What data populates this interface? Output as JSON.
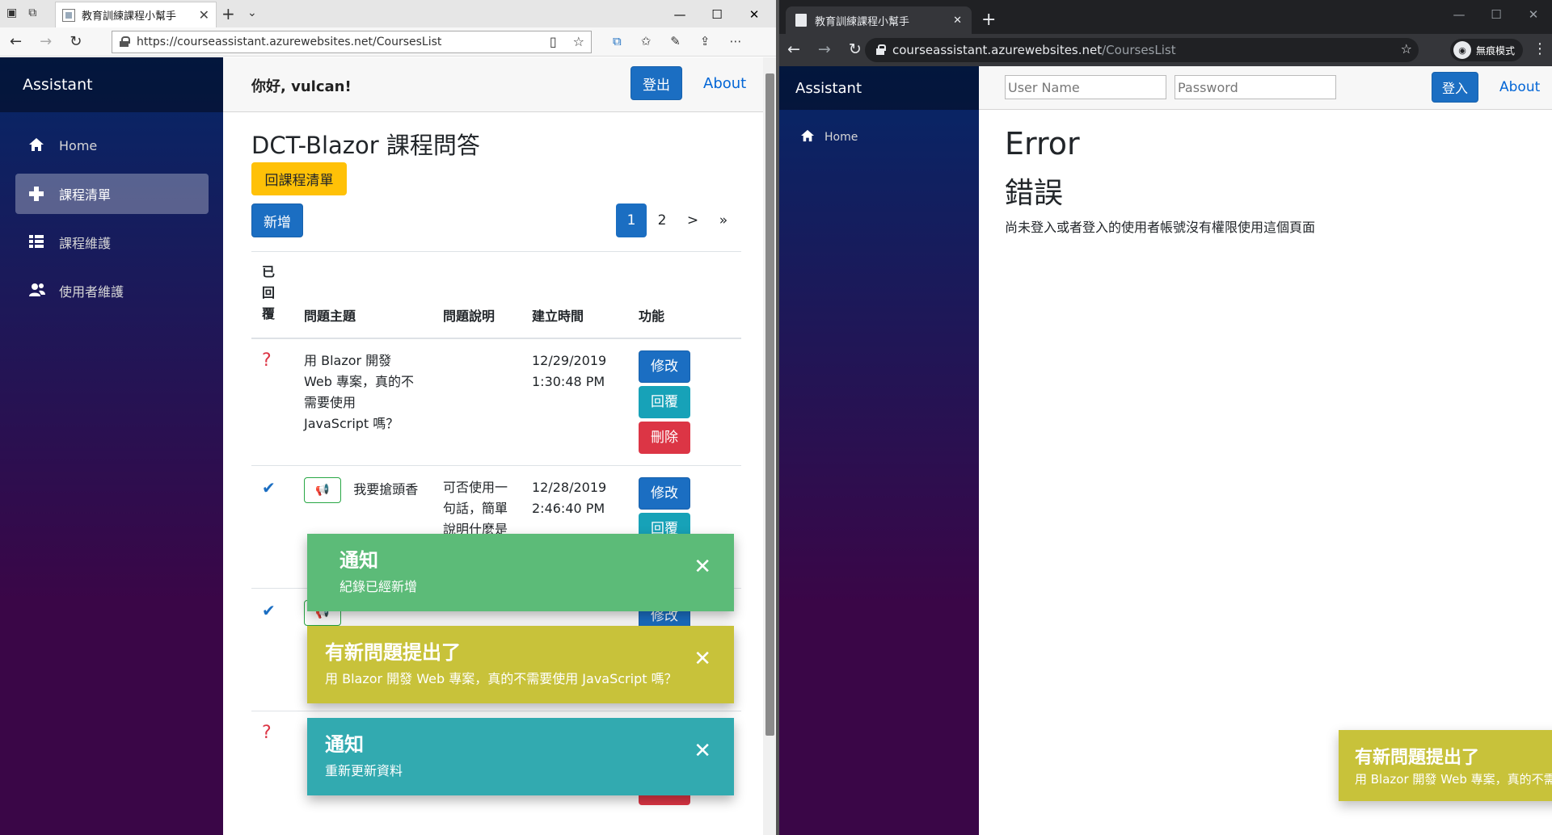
{
  "left": {
    "tab_title": "教育訓練課程小幫手",
    "url": "https://courseassistant.azurewebsites.net/CoursesList",
    "sidebar": {
      "brand": "Assistant",
      "items": [
        {
          "label": "Home",
          "icon": "home-icon"
        },
        {
          "label": "課程清單",
          "icon": "plus-icon"
        },
        {
          "label": "課程維護",
          "icon": "list-icon"
        },
        {
          "label": "使用者維護",
          "icon": "people-icon"
        }
      ]
    },
    "greeting": "你好, vulcan!",
    "logout_label": "登出",
    "about_label": "About",
    "page_title": "DCT-Blazor 課程問答",
    "back_label": "回課程清單",
    "add_label": "新增",
    "pager": [
      "1",
      "2",
      ">",
      "»"
    ],
    "columns": [
      "已回覆",
      "問題主題",
      "問題說明",
      "建立時間",
      "功能"
    ],
    "rows": [
      {
        "answered": "?",
        "subject": "用 Blazor 開發 Web 專案，真的不需要使用 JavaScript 嗎？",
        "desc": "",
        "date": "12/29/2019",
        "time": "1:30:48 PM"
      },
      {
        "answered": "✔",
        "subject": "我要搶頭香",
        "desc": "可否使用一句話，簡單說明什麼是",
        "date": "12/28/2019",
        "time": "2:46:40 PM"
      },
      {
        "answered": "✔",
        "subject": "",
        "desc": "",
        "date": "",
        "time": ""
      },
      {
        "answered": "?",
        "subject": "",
        "desc": "",
        "date": "",
        "time": ""
      }
    ],
    "btn_edit": "修改",
    "btn_reply": "回覆",
    "btn_delete": "刪除",
    "toasts": [
      {
        "title": "通知",
        "message": "紀錄已經新增",
        "color": "#5cbb78"
      },
      {
        "title": "有新問題提出了",
        "message": "用 Blazor 開發 Web 專案，真的不需要使用 JavaScript 嗎？",
        "color": "#c8c23a"
      },
      {
        "title": "通知",
        "message": "重新更新資料",
        "color": "#32aab0"
      }
    ]
  },
  "right": {
    "tab_title": "教育訓練課程小幫手",
    "url_host": "courseassistant.azurewebsites.net",
    "url_path": "/CoursesList",
    "incognito_label": "無痕模式",
    "brand": "Assistant",
    "home_label": "Home",
    "username_placeholder": "User Name",
    "password_placeholder": "Password",
    "login_label": "登入",
    "about_label": "About",
    "error_title": "Error",
    "error_title_zh": "錯誤",
    "error_message": "尚未登入或者登入的使用者帳號沒有權限使用這個頁面",
    "toast": {
      "title": "有新問題提出了",
      "message": "用 Blazor 開發 Web 專案，真的不需要使用 JavaScript 嗎？",
      "color": "#c8c23a"
    }
  }
}
